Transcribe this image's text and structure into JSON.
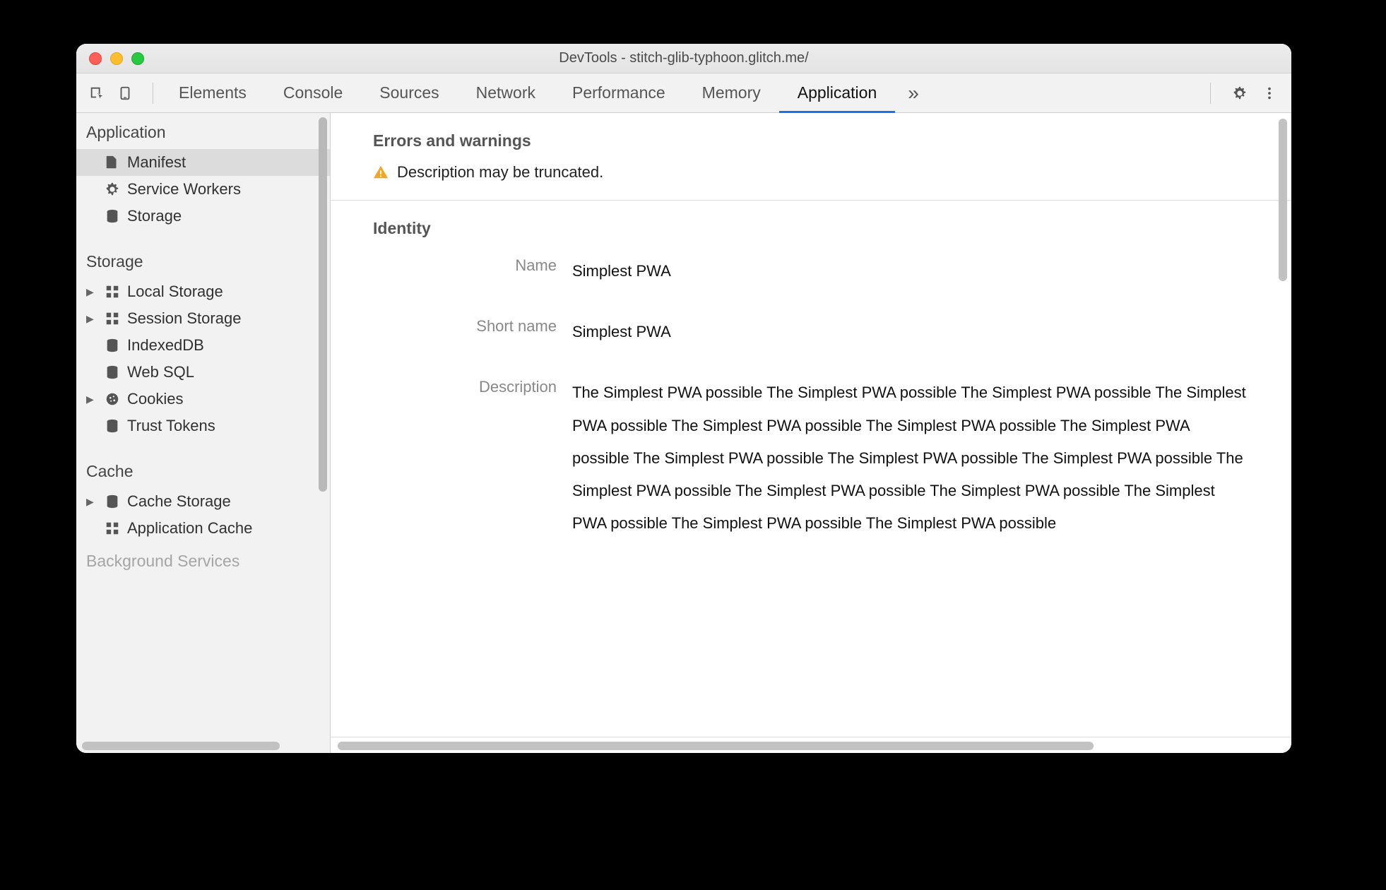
{
  "window": {
    "title": "DevTools - stitch-glib-typhoon.glitch.me/"
  },
  "tabs": {
    "items": [
      "Elements",
      "Console",
      "Sources",
      "Network",
      "Performance",
      "Memory",
      "Application"
    ],
    "active_index": 6
  },
  "sidebar": {
    "sections": {
      "application": {
        "label": "Application",
        "items": [
          {
            "label": "Manifest",
            "icon": "document-icon",
            "selected": true
          },
          {
            "label": "Service Workers",
            "icon": "gear-icon"
          },
          {
            "label": "Storage",
            "icon": "database-icon"
          }
        ]
      },
      "storage": {
        "label": "Storage",
        "items": [
          {
            "label": "Local Storage",
            "icon": "grid-icon",
            "expandable": true
          },
          {
            "label": "Session Storage",
            "icon": "grid-icon",
            "expandable": true
          },
          {
            "label": "IndexedDB",
            "icon": "database-icon"
          },
          {
            "label": "Web SQL",
            "icon": "database-icon"
          },
          {
            "label": "Cookies",
            "icon": "cookie-icon",
            "expandable": true
          },
          {
            "label": "Trust Tokens",
            "icon": "database-icon"
          }
        ]
      },
      "cache": {
        "label": "Cache",
        "items": [
          {
            "label": "Cache Storage",
            "icon": "database-icon",
            "expandable": true
          },
          {
            "label": "Application Cache",
            "icon": "grid-icon"
          }
        ]
      },
      "background_services": {
        "label": "Background Services"
      }
    }
  },
  "main": {
    "errors_section": {
      "heading": "Errors and warnings",
      "warning": "Description may be truncated."
    },
    "identity_section": {
      "heading": "Identity",
      "name_label": "Name",
      "name_value": "Simplest PWA",
      "short_name_label": "Short name",
      "short_name_value": "Simplest PWA",
      "description_label": "Description",
      "description_value": "The Simplest PWA possible The Simplest PWA possible The Simplest PWA possible The Simplest PWA possible The Simplest PWA possible The Simplest PWA possible The Simplest PWA possible The Simplest PWA possible The Simplest PWA possible The Simplest PWA possible The Simplest PWA possible The Simplest PWA possible The Simplest PWA possible The Simplest PWA possible The Simplest PWA possible The Simplest PWA possible"
    }
  }
}
